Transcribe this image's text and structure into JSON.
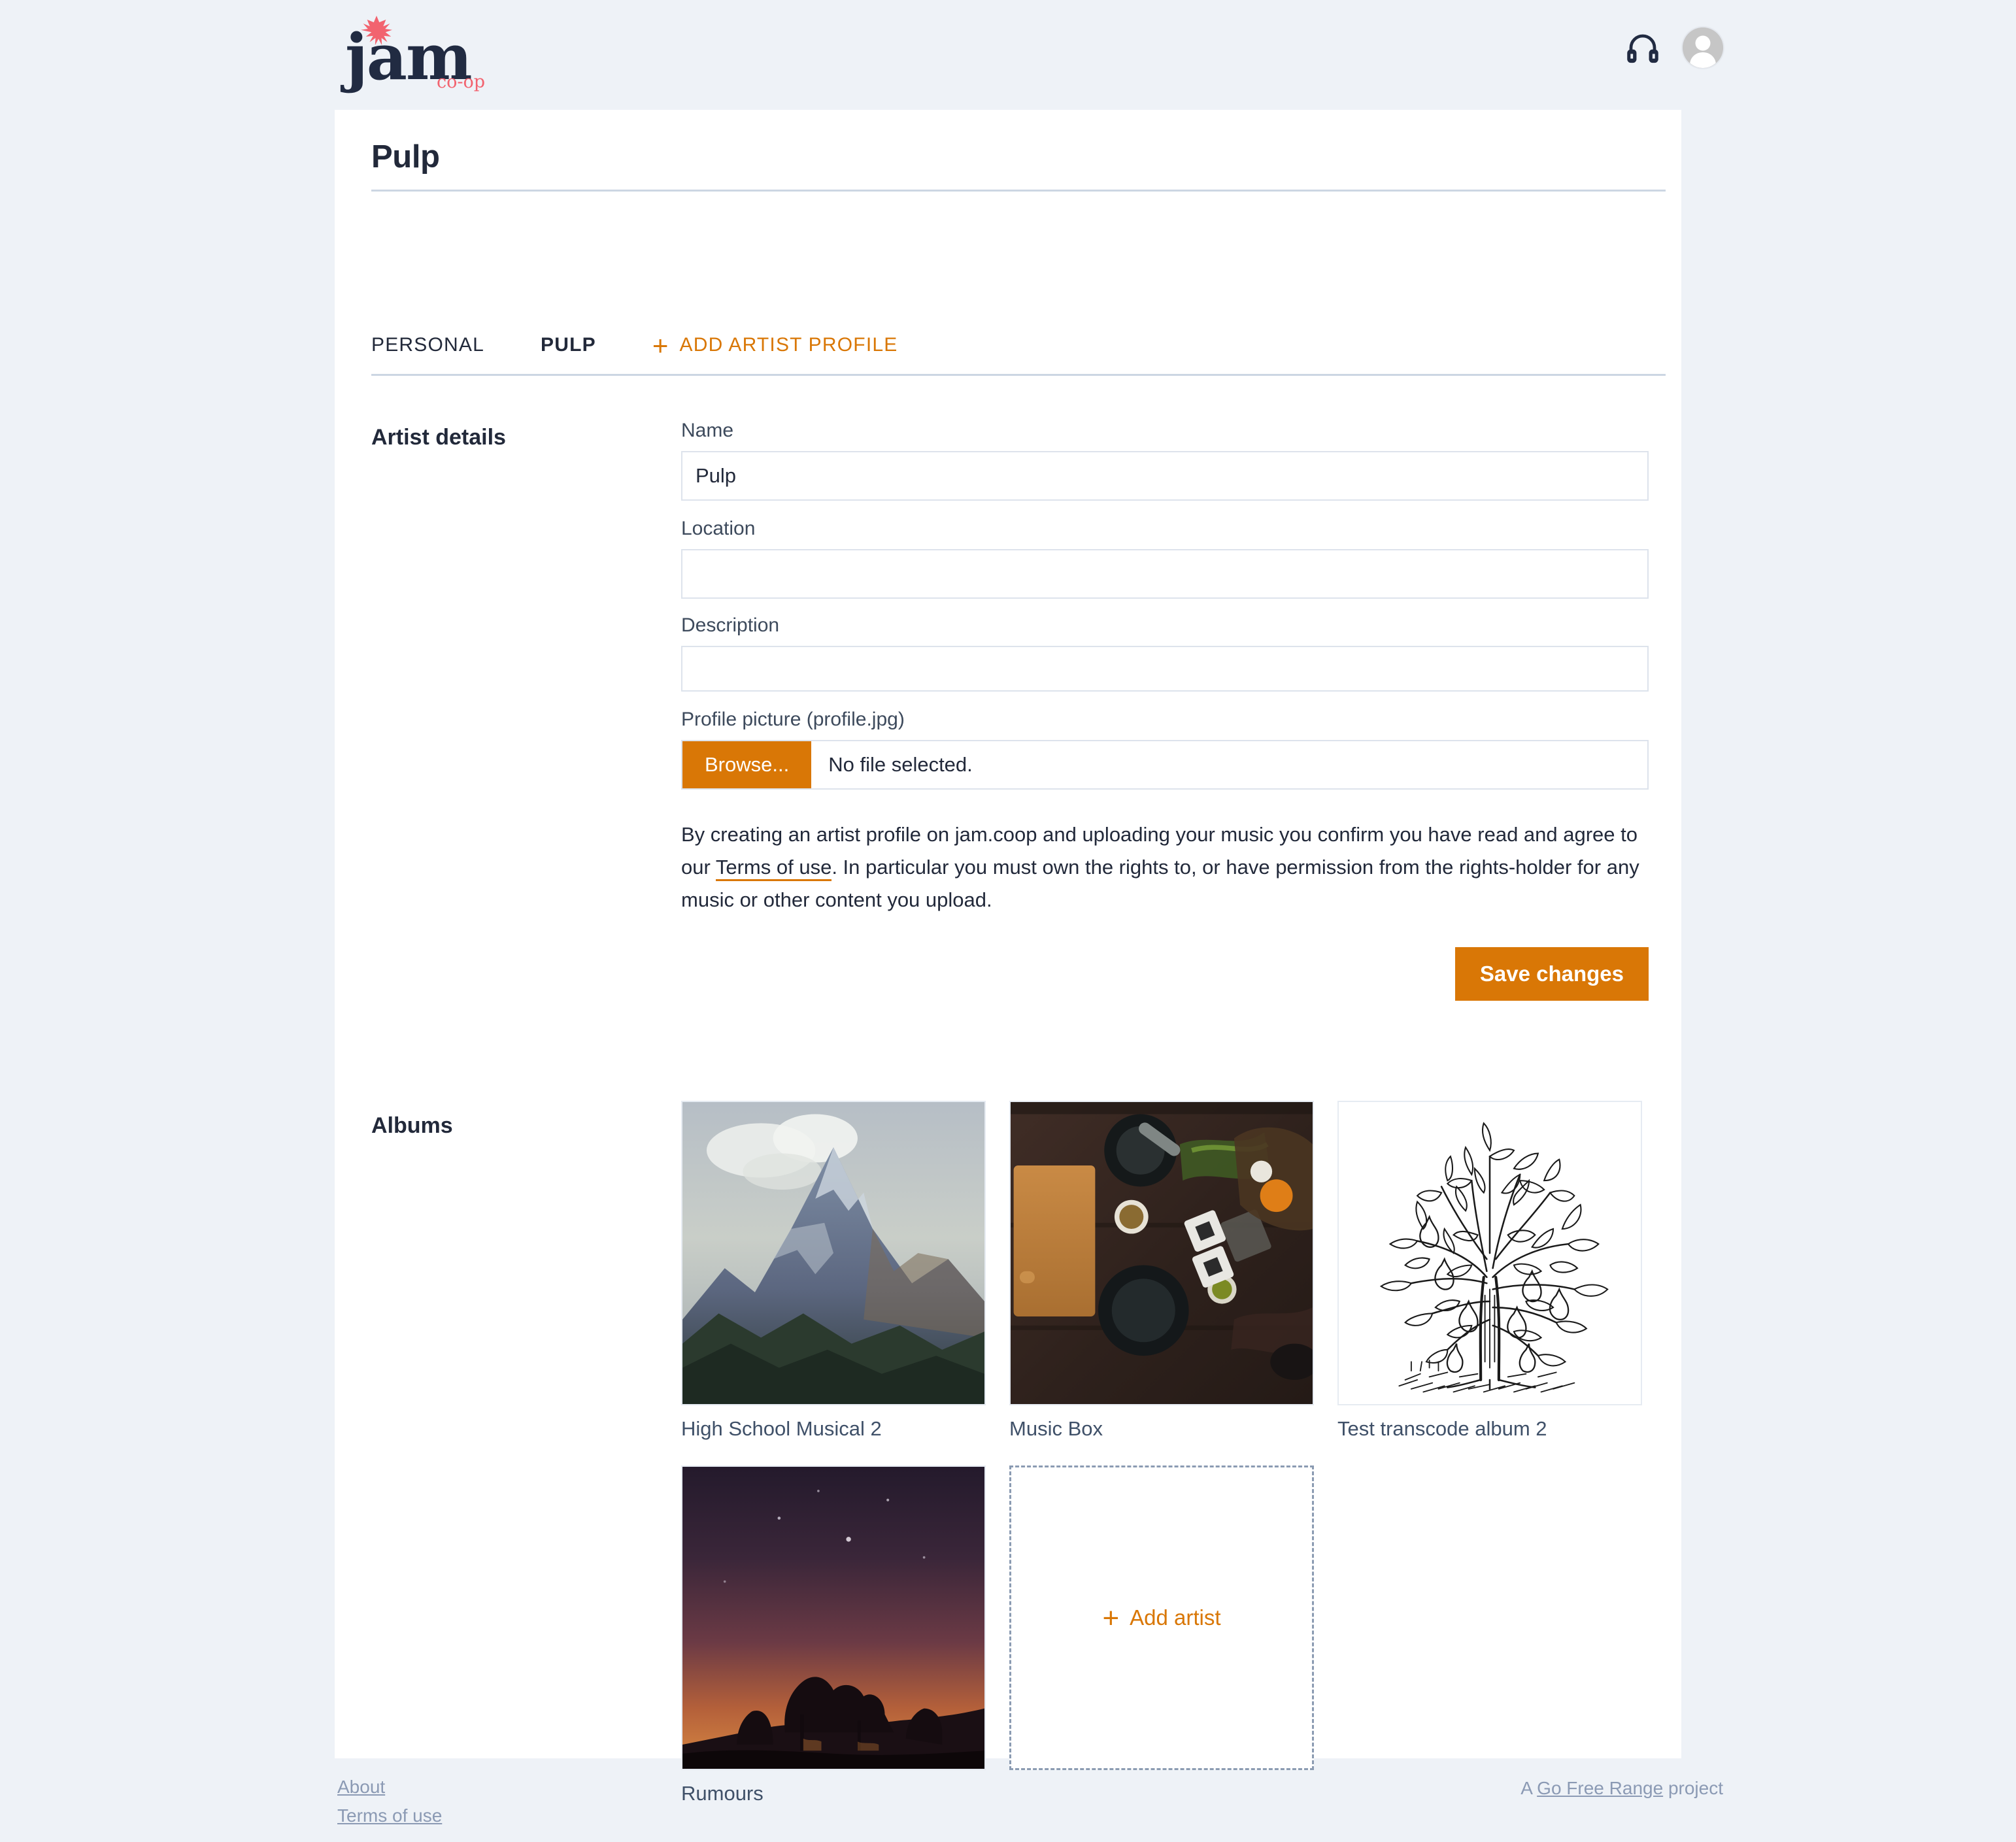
{
  "brand": {
    "word": "jam",
    "suffix": "co-op",
    "star_icon": "star-icon",
    "star_color": "#f2636f",
    "word_color": "#212b42"
  },
  "topbar": {
    "headphones_icon": "headphones-icon",
    "avatar_icon": "user-avatar-icon"
  },
  "page": {
    "title": "Pulp"
  },
  "tabs": {
    "items": [
      {
        "label": "PERSONAL",
        "active": false
      },
      {
        "label": "PULP",
        "active": true
      }
    ],
    "add_profile": {
      "label": "ADD ARTIST PROFILE",
      "plus": "+"
    }
  },
  "artist_details": {
    "section_label": "Artist details",
    "fields": {
      "name": {
        "label": "Name",
        "value": "Pulp",
        "placeholder": ""
      },
      "location": {
        "label": "Location",
        "value": "",
        "placeholder": ""
      },
      "description": {
        "label": "Description",
        "value": "",
        "placeholder": ""
      },
      "profile_picture": {
        "label": "Profile picture (profile.jpg)",
        "browse_label": "Browse...",
        "file_status": "No file selected."
      }
    },
    "terms_text_before": "By creating an artist profile on jam.coop and uploading your music you confirm you have read and agree to our ",
    "terms_link_label": "Terms of use",
    "terms_text_after": ". In particular you must own the rights to, or have permission from the rights-holder for any music or other content you upload.",
    "save_label": "Save changes"
  },
  "albums": {
    "section_label": "Albums",
    "items": [
      {
        "title": "High School Musical 2",
        "art": "mountain-peak"
      },
      {
        "title": "Music Box",
        "art": "kitchen-table"
      },
      {
        "title": "Test transcode album 2",
        "art": "pear-tree-engraving"
      },
      {
        "title": "Rumours",
        "art": "dusk-sky"
      }
    ],
    "add_artist": {
      "label": "Add artist",
      "plus": "+"
    }
  },
  "footer": {
    "links": [
      {
        "label": "About"
      },
      {
        "label": "Terms of use"
      }
    ],
    "credit_before": "A ",
    "credit_link": "Go Free Range",
    "credit_after": " project"
  },
  "colors": {
    "accent": "#d97706",
    "brand_dark": "#212b42",
    "brand_pink": "#f2636f",
    "page_bg": "#eef2f7",
    "card_bg": "#ffffff",
    "border": "#dde3ec",
    "muted_text": "#8b9ab4"
  }
}
